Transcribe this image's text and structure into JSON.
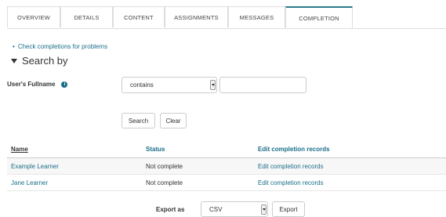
{
  "tabs": [
    {
      "label": "OVERVIEW"
    },
    {
      "label": "DETAILS"
    },
    {
      "label": "CONTENT"
    },
    {
      "label": "ASSIGNMENTS"
    },
    {
      "label": "MESSAGES"
    },
    {
      "label": "COMPLETION",
      "active": true
    }
  ],
  "links": {
    "check_problems": "Check completions for problems"
  },
  "search": {
    "heading": "Search by",
    "field_label": "User's Fullname",
    "operator": "contains",
    "value": "",
    "search_button": "Search",
    "clear_button": "Clear"
  },
  "table": {
    "headers": {
      "name": "Name",
      "status": "Status",
      "edit": "Edit completion records"
    },
    "rows": [
      {
        "name": "Example Learner",
        "status": "Not complete",
        "edit": "Edit completion records"
      },
      {
        "name": "Jane Learner",
        "status": "Not complete",
        "edit": "Edit completion records"
      }
    ]
  },
  "export": {
    "label": "Export as",
    "format": "CSV",
    "button": "Export"
  },
  "colors": {
    "link": "#1a6e8a",
    "active_tab_border": "#2a7a8a"
  }
}
